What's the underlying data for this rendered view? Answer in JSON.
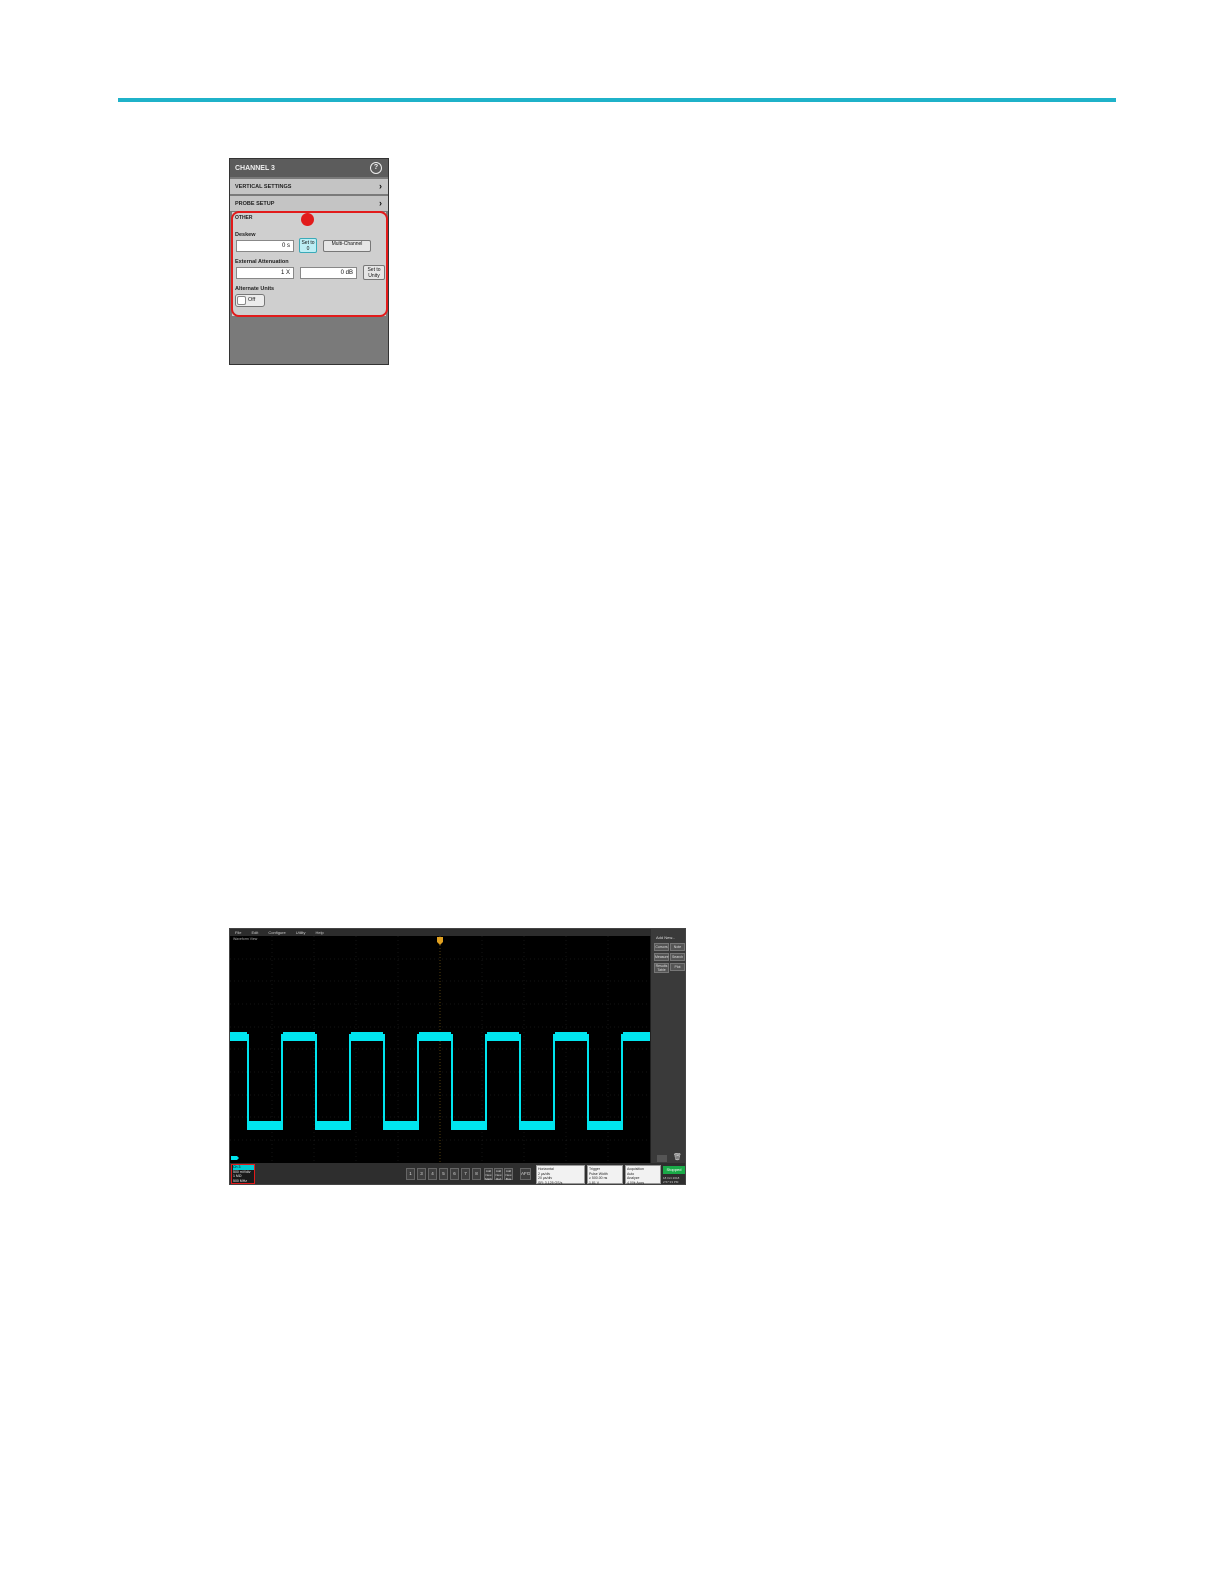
{
  "colors": {
    "accent_rule": "#1fb2c9",
    "highlight": "#e21b1b",
    "trace": "#00e5ef"
  },
  "panel": {
    "title": "CHANNEL 3",
    "help_icon": "?",
    "vertical_settings": "VERTICAL SETTINGS",
    "probe_setup": "PROBE SETUP",
    "other": "OTHER",
    "deskew_label": "Deskew",
    "deskew_value": "0 s",
    "set_to_0": "Set to 0",
    "multi_channel": "Multi-Channel",
    "ext_atten_label": "External Attenuation",
    "ext_atten_x": "1 X",
    "ext_atten_db": "0 dB",
    "set_to_unity": "Set to Unity",
    "alt_units_label": "Alternate Units",
    "alt_units_value": "Off"
  },
  "scope": {
    "menu": [
      "File",
      "Edit",
      "Configure",
      "Utility",
      "Help"
    ],
    "waveform_view": "Waveform View",
    "side_title": "Add New...",
    "side_buttons": [
      "Cursors",
      "Note",
      "Measure",
      "Search",
      "Results Table",
      "Plot"
    ],
    "channel_badge": [
      "Ch 3",
      "500 mV/div",
      "1 MΩ",
      "500 MHz"
    ],
    "channel_numbers": [
      "1",
      "3",
      "4",
      "5",
      "6",
      "7",
      "8"
    ],
    "add_new": [
      "Add New Math",
      "Add New Ref",
      "Add New Bus"
    ],
    "afg": "AFG",
    "horizontal": [
      "Horizontal",
      "2 µs/div",
      "20 µs/div",
      "SR: 3.125 GS/s",
      "RL: 62.5 kpts"
    ],
    "trigger": [
      "Trigger",
      "Pulse Width",
      "≥ 500.00 ns",
      "1.81 V"
    ],
    "acquisition": [
      "Acquisition",
      "Auto",
      "Analyze",
      "4.00k Acqs"
    ],
    "run_state": "Stopped",
    "datetime": [
      "18 Oct 2018",
      "2:57:33 PM"
    ]
  }
}
